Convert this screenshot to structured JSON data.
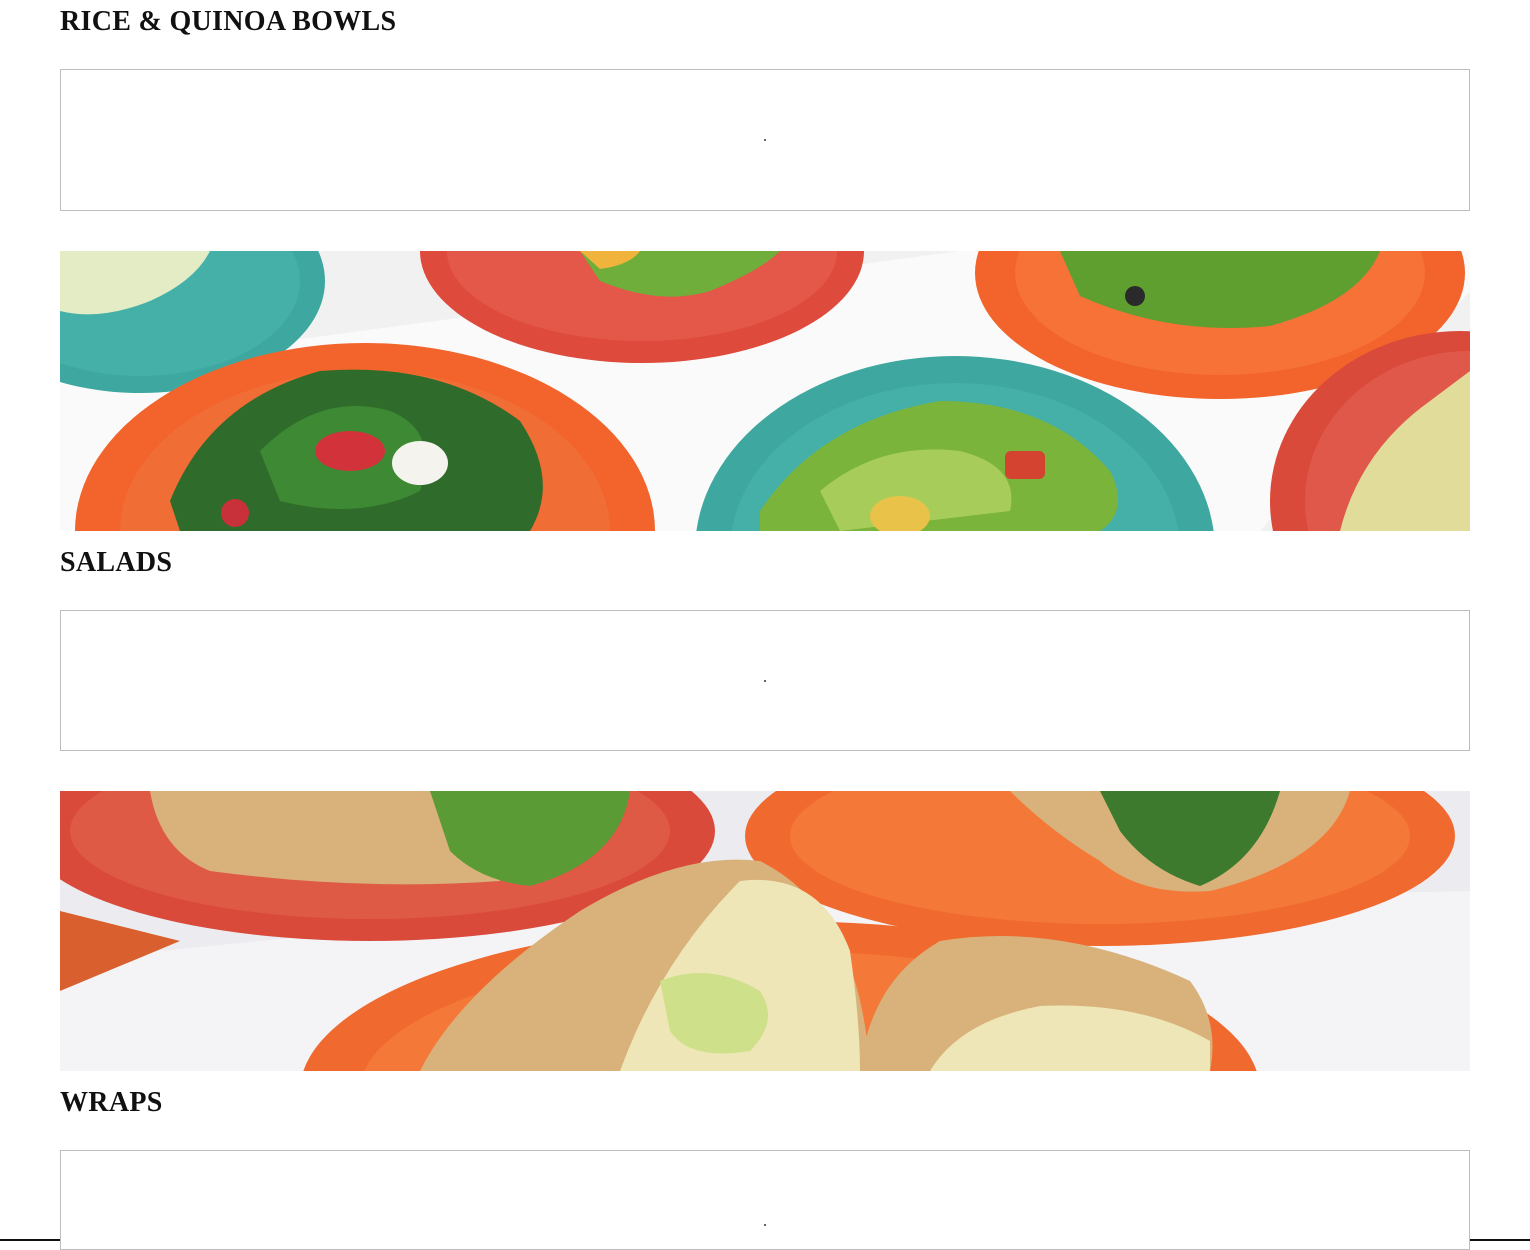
{
  "sections": [
    {
      "title": "RICE & QUINOA BOWLS"
    },
    {
      "title": "SALADS"
    },
    {
      "title": "WRAPS"
    }
  ],
  "banners": [
    {
      "subject": "salads on colorful plates",
      "colors": {
        "teal": "#3ea79f",
        "red": "#de4b3c",
        "orange": "#f2642b",
        "green": "#5f9f2f"
      }
    },
    {
      "subject": "wraps on orange plates",
      "colors": {
        "orange": "#f0692e",
        "red": "#d94a3b",
        "tortilla": "#d8b27a",
        "slaw": "#efe6b8"
      }
    }
  ]
}
